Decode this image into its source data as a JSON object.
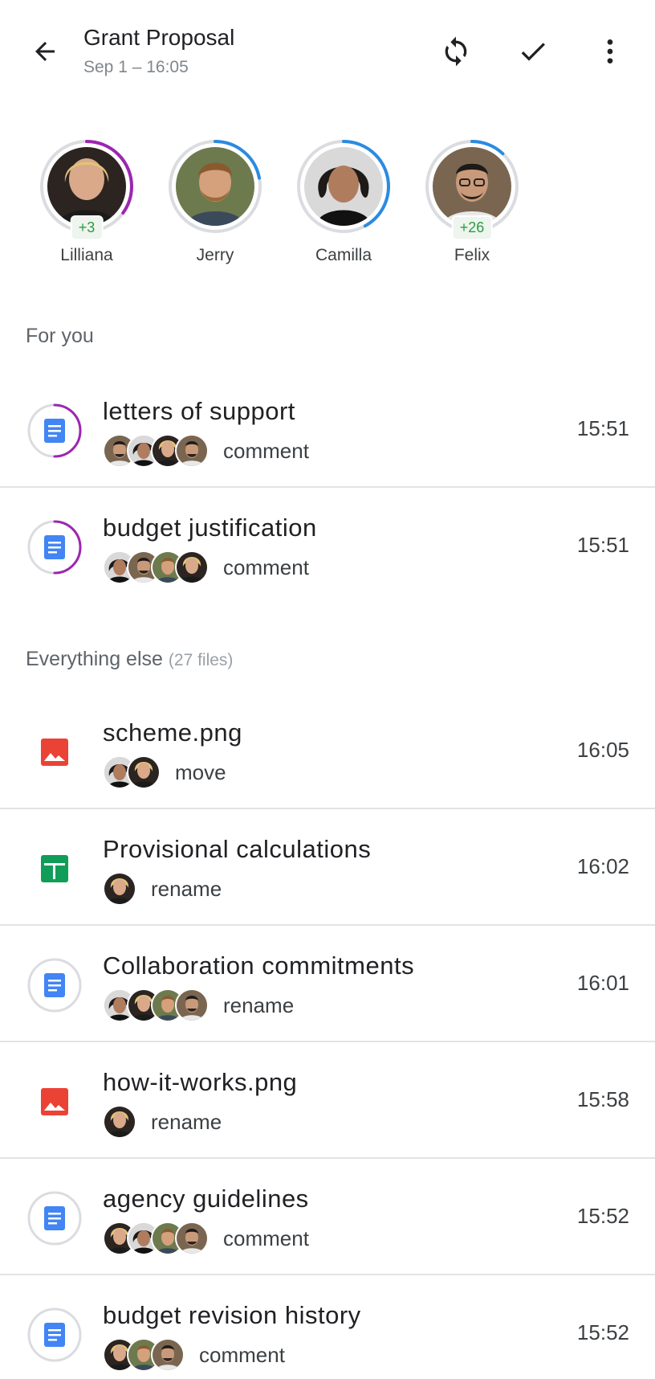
{
  "header": {
    "title": "Grant Proposal",
    "subtitle": "Sep 1 – 16:05"
  },
  "people": [
    {
      "name": "Lilliana",
      "badge": "+3",
      "ring_color": "#9c27b0",
      "ring_fraction": 0.35
    },
    {
      "name": "Jerry",
      "badge": "",
      "ring_color": "#2b8be0",
      "ring_fraction": 0.22
    },
    {
      "name": "Camilla",
      "badge": "",
      "ring_color": "#2b8be0",
      "ring_fraction": 0.42
    },
    {
      "name": "Felix",
      "badge": "+26",
      "ring_color": "#2b8be0",
      "ring_fraction": 0.12
    }
  ],
  "sections": {
    "for_you": {
      "label": "For you"
    },
    "everything_else": {
      "label": "Everything else",
      "count": "(27 files)"
    }
  },
  "for_you_items": [
    {
      "title": "letters of support",
      "action": "comment",
      "time": "15:51",
      "icon": "doc-icon",
      "ring_color": "#9c27b0",
      "avatars": [
        "felix",
        "camilla",
        "lilliana",
        "felix"
      ]
    },
    {
      "title": "budget justification",
      "action": "comment",
      "time": "15:51",
      "icon": "doc-icon",
      "ring_color": "#9c27b0",
      "avatars": [
        "camilla",
        "felix",
        "jerry",
        "lilliana"
      ]
    }
  ],
  "everything_items": [
    {
      "title": "scheme.png",
      "action": "move",
      "time": "16:05",
      "icon": "image-icon",
      "avatars": [
        "camilla",
        "lilliana"
      ]
    },
    {
      "title": "Provisional calculations",
      "action": "rename",
      "time": "16:02",
      "icon": "sheet-icon",
      "avatars": [
        "lilliana"
      ]
    },
    {
      "title": "Collaboration commitments",
      "action": "rename",
      "time": "16:01",
      "icon": "doc-icon",
      "avatars": [
        "camilla",
        "lilliana",
        "jerry",
        "felix"
      ]
    },
    {
      "title": "how-it-works.png",
      "action": "rename",
      "time": "15:58",
      "icon": "image-icon",
      "avatars": [
        "lilliana"
      ]
    },
    {
      "title": "agency guidelines",
      "action": "comment",
      "time": "15:52",
      "icon": "doc-icon",
      "avatars": [
        "lilliana",
        "camilla",
        "jerry",
        "felix"
      ]
    },
    {
      "title": "budget revision history",
      "action": "comment",
      "time": "15:52",
      "icon": "doc-icon",
      "avatars": [
        "lilliana",
        "jerry",
        "felix"
      ]
    }
  ],
  "colors": {
    "doc_blue": "#4285f4",
    "image_red": "#ea4335",
    "sheet_green": "#0f9d58",
    "ring_gray": "#dadce0",
    "badge_green": "#2e9b41"
  }
}
